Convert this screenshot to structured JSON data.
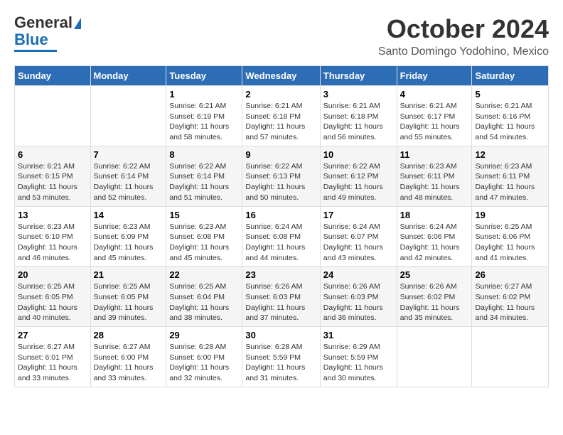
{
  "logo": {
    "line1": "General",
    "line2": "Blue"
  },
  "title": {
    "month": "October 2024",
    "location": "Santo Domingo Yodohino, Mexico"
  },
  "days_of_week": [
    "Sunday",
    "Monday",
    "Tuesday",
    "Wednesday",
    "Thursday",
    "Friday",
    "Saturday"
  ],
  "weeks": [
    [
      {
        "day": "",
        "sunrise": "",
        "sunset": "",
        "daylight": ""
      },
      {
        "day": "",
        "sunrise": "",
        "sunset": "",
        "daylight": ""
      },
      {
        "day": "1",
        "sunrise": "Sunrise: 6:21 AM",
        "sunset": "Sunset: 6:19 PM",
        "daylight": "Daylight: 11 hours and 58 minutes."
      },
      {
        "day": "2",
        "sunrise": "Sunrise: 6:21 AM",
        "sunset": "Sunset: 6:18 PM",
        "daylight": "Daylight: 11 hours and 57 minutes."
      },
      {
        "day": "3",
        "sunrise": "Sunrise: 6:21 AM",
        "sunset": "Sunset: 6:18 PM",
        "daylight": "Daylight: 11 hours and 56 minutes."
      },
      {
        "day": "4",
        "sunrise": "Sunrise: 6:21 AM",
        "sunset": "Sunset: 6:17 PM",
        "daylight": "Daylight: 11 hours and 55 minutes."
      },
      {
        "day": "5",
        "sunrise": "Sunrise: 6:21 AM",
        "sunset": "Sunset: 6:16 PM",
        "daylight": "Daylight: 11 hours and 54 minutes."
      }
    ],
    [
      {
        "day": "6",
        "sunrise": "Sunrise: 6:21 AM",
        "sunset": "Sunset: 6:15 PM",
        "daylight": "Daylight: 11 hours and 53 minutes."
      },
      {
        "day": "7",
        "sunrise": "Sunrise: 6:22 AM",
        "sunset": "Sunset: 6:14 PM",
        "daylight": "Daylight: 11 hours and 52 minutes."
      },
      {
        "day": "8",
        "sunrise": "Sunrise: 6:22 AM",
        "sunset": "Sunset: 6:14 PM",
        "daylight": "Daylight: 11 hours and 51 minutes."
      },
      {
        "day": "9",
        "sunrise": "Sunrise: 6:22 AM",
        "sunset": "Sunset: 6:13 PM",
        "daylight": "Daylight: 11 hours and 50 minutes."
      },
      {
        "day": "10",
        "sunrise": "Sunrise: 6:22 AM",
        "sunset": "Sunset: 6:12 PM",
        "daylight": "Daylight: 11 hours and 49 minutes."
      },
      {
        "day": "11",
        "sunrise": "Sunrise: 6:23 AM",
        "sunset": "Sunset: 6:11 PM",
        "daylight": "Daylight: 11 hours and 48 minutes."
      },
      {
        "day": "12",
        "sunrise": "Sunrise: 6:23 AM",
        "sunset": "Sunset: 6:11 PM",
        "daylight": "Daylight: 11 hours and 47 minutes."
      }
    ],
    [
      {
        "day": "13",
        "sunrise": "Sunrise: 6:23 AM",
        "sunset": "Sunset: 6:10 PM",
        "daylight": "Daylight: 11 hours and 46 minutes."
      },
      {
        "day": "14",
        "sunrise": "Sunrise: 6:23 AM",
        "sunset": "Sunset: 6:09 PM",
        "daylight": "Daylight: 11 hours and 45 minutes."
      },
      {
        "day": "15",
        "sunrise": "Sunrise: 6:23 AM",
        "sunset": "Sunset: 6:08 PM",
        "daylight": "Daylight: 11 hours and 45 minutes."
      },
      {
        "day": "16",
        "sunrise": "Sunrise: 6:24 AM",
        "sunset": "Sunset: 6:08 PM",
        "daylight": "Daylight: 11 hours and 44 minutes."
      },
      {
        "day": "17",
        "sunrise": "Sunrise: 6:24 AM",
        "sunset": "Sunset: 6:07 PM",
        "daylight": "Daylight: 11 hours and 43 minutes."
      },
      {
        "day": "18",
        "sunrise": "Sunrise: 6:24 AM",
        "sunset": "Sunset: 6:06 PM",
        "daylight": "Daylight: 11 hours and 42 minutes."
      },
      {
        "day": "19",
        "sunrise": "Sunrise: 6:25 AM",
        "sunset": "Sunset: 6:06 PM",
        "daylight": "Daylight: 11 hours and 41 minutes."
      }
    ],
    [
      {
        "day": "20",
        "sunrise": "Sunrise: 6:25 AM",
        "sunset": "Sunset: 6:05 PM",
        "daylight": "Daylight: 11 hours and 40 minutes."
      },
      {
        "day": "21",
        "sunrise": "Sunrise: 6:25 AM",
        "sunset": "Sunset: 6:05 PM",
        "daylight": "Daylight: 11 hours and 39 minutes."
      },
      {
        "day": "22",
        "sunrise": "Sunrise: 6:25 AM",
        "sunset": "Sunset: 6:04 PM",
        "daylight": "Daylight: 11 hours and 38 minutes."
      },
      {
        "day": "23",
        "sunrise": "Sunrise: 6:26 AM",
        "sunset": "Sunset: 6:03 PM",
        "daylight": "Daylight: 11 hours and 37 minutes."
      },
      {
        "day": "24",
        "sunrise": "Sunrise: 6:26 AM",
        "sunset": "Sunset: 6:03 PM",
        "daylight": "Daylight: 11 hours and 36 minutes."
      },
      {
        "day": "25",
        "sunrise": "Sunrise: 6:26 AM",
        "sunset": "Sunset: 6:02 PM",
        "daylight": "Daylight: 11 hours and 35 minutes."
      },
      {
        "day": "26",
        "sunrise": "Sunrise: 6:27 AM",
        "sunset": "Sunset: 6:02 PM",
        "daylight": "Daylight: 11 hours and 34 minutes."
      }
    ],
    [
      {
        "day": "27",
        "sunrise": "Sunrise: 6:27 AM",
        "sunset": "Sunset: 6:01 PM",
        "daylight": "Daylight: 11 hours and 33 minutes."
      },
      {
        "day": "28",
        "sunrise": "Sunrise: 6:27 AM",
        "sunset": "Sunset: 6:00 PM",
        "daylight": "Daylight: 11 hours and 33 minutes."
      },
      {
        "day": "29",
        "sunrise": "Sunrise: 6:28 AM",
        "sunset": "Sunset: 6:00 PM",
        "daylight": "Daylight: 11 hours and 32 minutes."
      },
      {
        "day": "30",
        "sunrise": "Sunrise: 6:28 AM",
        "sunset": "Sunset: 5:59 PM",
        "daylight": "Daylight: 11 hours and 31 minutes."
      },
      {
        "day": "31",
        "sunrise": "Sunrise: 6:29 AM",
        "sunset": "Sunset: 5:59 PM",
        "daylight": "Daylight: 11 hours and 30 minutes."
      },
      {
        "day": "",
        "sunrise": "",
        "sunset": "",
        "daylight": ""
      },
      {
        "day": "",
        "sunrise": "",
        "sunset": "",
        "daylight": ""
      }
    ]
  ]
}
